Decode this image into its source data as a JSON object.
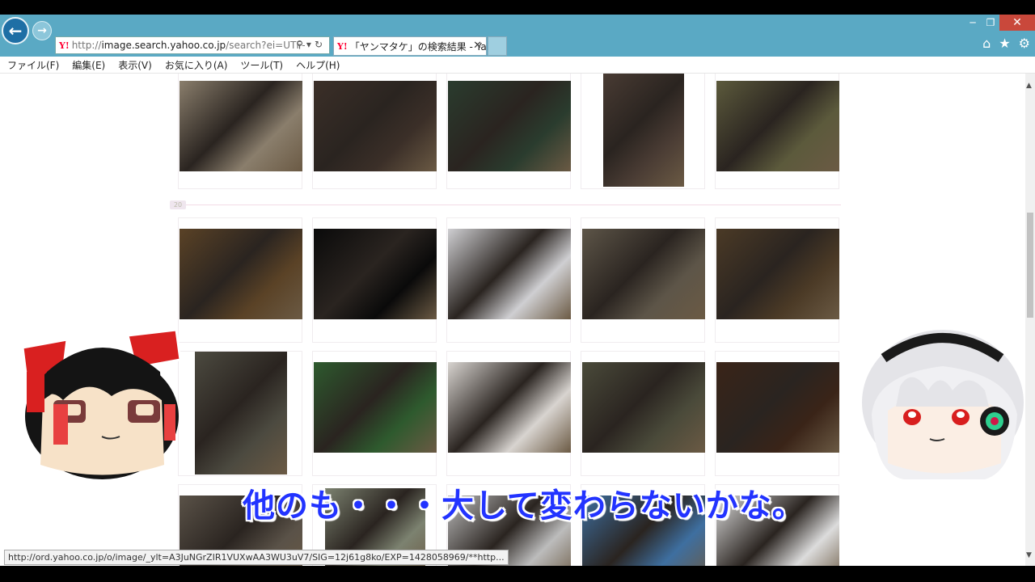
{
  "browser": {
    "address_url": "http://image.search.yahoo.co.jp/search?ei=UTF-",
    "address_prefix": "http://",
    "address_host": "image.search.yahoo.co.jp",
    "address_path": "/search?ei=UTF-",
    "address_buttons": "⚲▾↻",
    "yahoo_logo": "Y!",
    "tab_title": "「ヤンマタケ」の検索結果 - Ya...",
    "tab_close": "✕",
    "window_controls": [
      "─",
      "❐",
      "✕"
    ],
    "tool_icons": [
      "⌂",
      "★",
      "⚙"
    ]
  },
  "menu": {
    "items": [
      "ファイル(F)",
      "編集(E)",
      "表示(V)",
      "お気に入り(A)",
      "ツール(T)",
      "ヘルプ(H)"
    ]
  },
  "results": {
    "page_marker": "20"
  },
  "status_bar": {
    "url": "http://ord.yahoo.co.jp/o/image/_ylt=A3JuNGrZIR1VUXwAA3WU3uV7/SIG=12j61g8ko/EXP=1428058969/**http..."
  },
  "overlay": {
    "subtitle": "他のも・・・大して変わらないかな。"
  },
  "colors": {
    "browser_frame": "#5aa9c4",
    "subtitle_text": "#2233ff",
    "close_button": "#c9483b"
  },
  "icons": {
    "back": "back-arrow-icon",
    "forward": "forward-arrow-icon",
    "home": "home-icon",
    "favorites": "star-icon",
    "tools": "gear-icon"
  }
}
